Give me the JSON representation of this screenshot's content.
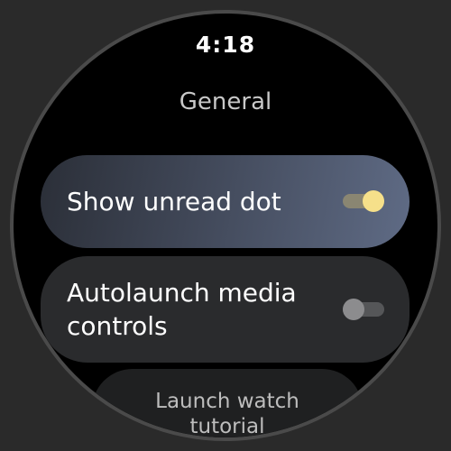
{
  "status": {
    "time": "4:18"
  },
  "header": {
    "title": "General"
  },
  "settings": [
    {
      "label": "Show unread dot",
      "toggle_on": true
    },
    {
      "label_line1": "Autolaunch media",
      "label_line2": "controls",
      "toggle_on": false
    },
    {
      "label_line1": "Launch watch",
      "label_line2": "tutorial"
    }
  ],
  "colors": {
    "toggle_on_thumb": "#f6e08a",
    "toggle_on_track": "#8a8672",
    "toggle_off_thumb": "#8c8c8e",
    "toggle_off_track": "#555658",
    "highlight_chip_end": "#5f6b85"
  }
}
